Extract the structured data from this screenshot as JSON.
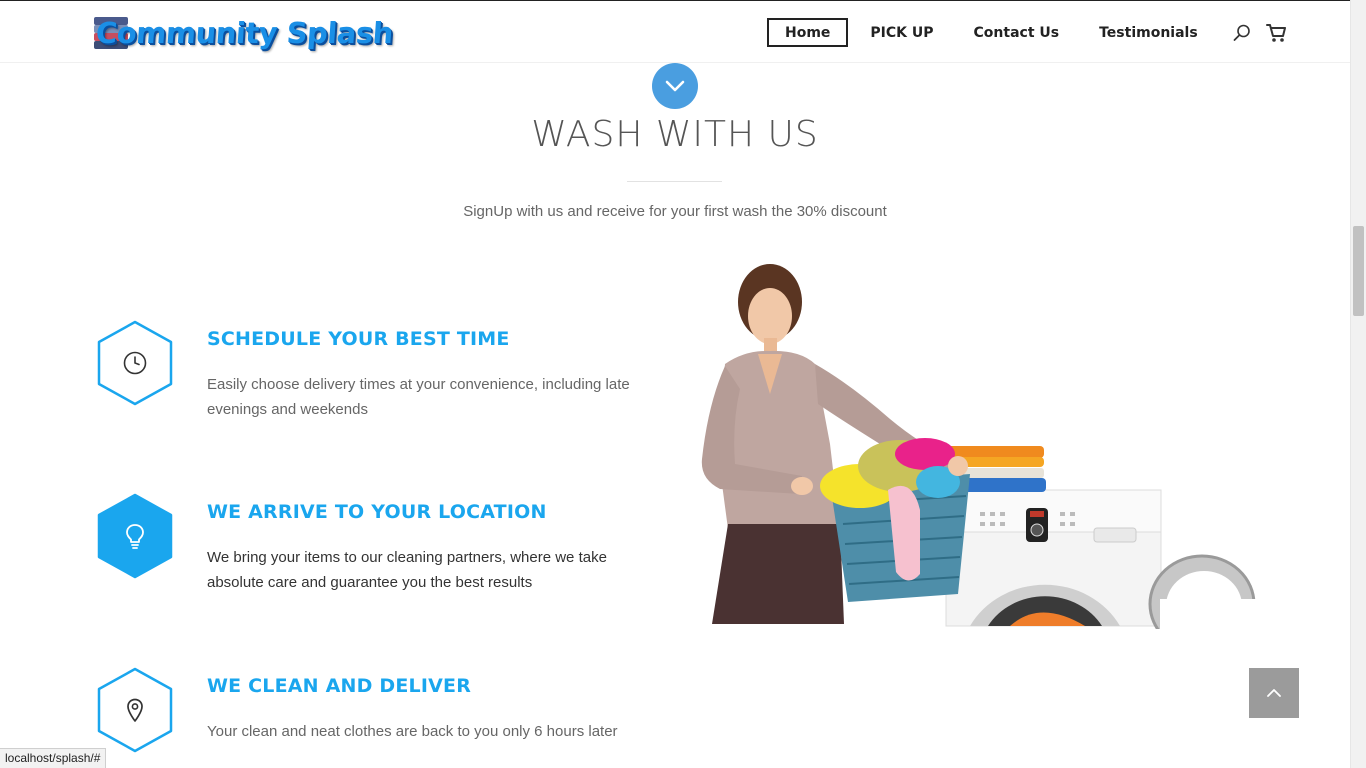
{
  "header": {
    "logo_text": "Community Splash",
    "nav": [
      {
        "label": "Home",
        "active": true
      },
      {
        "label": "PICK UP",
        "active": false
      },
      {
        "label": "Contact Us",
        "active": false
      },
      {
        "label": "Testimonials",
        "active": false
      }
    ],
    "icons": [
      "search-icon",
      "cart-icon"
    ]
  },
  "intro": {
    "scroll_icon": "chevron-down-icon",
    "title": "WASH WITH US",
    "subtitle": "SignUp with us and receive for your first wash the 30% discount"
  },
  "features": [
    {
      "icon": "clock-icon",
      "title": "SCHEDULE YOUR BEST TIME",
      "description": "Easily choose delivery times at your convenience, including late evenings and weekends",
      "highlighted": false
    },
    {
      "icon": "lightbulb-icon",
      "title": "WE ARRIVE TO YOUR LOCATION",
      "description": "We bring your items to our cleaning partners, where we take absolute care and guarantee you the best results",
      "highlighted": true
    },
    {
      "icon": "location-pin-icon",
      "title": "WE CLEAN AND DELIVER",
      "description": "Your clean and neat clothes are back to you only 6 hours later",
      "highlighted": false
    }
  ],
  "back_to_top_icon": "chevron-up-icon",
  "status_bar": {
    "url": "localhost/splash/#"
  },
  "colors": {
    "accent": "#1aa6ee",
    "circle_blue": "#4a9ee0",
    "back_top_gray": "#9b9b9b",
    "text_dark": "#222222"
  }
}
